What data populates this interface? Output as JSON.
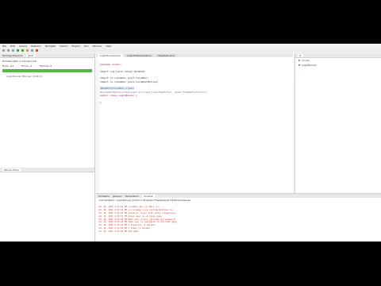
{
  "menu": [
    "File",
    "Edit",
    "Source",
    "Refactor",
    "Navigate",
    "Search",
    "Project",
    "Run",
    "Window",
    "Help"
  ],
  "left": {
    "tabs": [
      "Package Explorer",
      "JUnit"
    ],
    "junit_info": "Finished after 2.144 seconds",
    "runs": "Runs: 1/1",
    "errors": "Errors: 0",
    "failures": "Failures: 0",
    "tree_item": "LoginRunner [Runner: JUnit 4]",
    "problems_tab": "Failure Trace"
  },
  "editor": {
    "tabs": [
      "LoginRunner.java",
      "LoginFeature.feature",
      "StepDefs.java"
    ],
    "lines": [
      "package runner;",
      "",
      "import org.junit.runner.RunWith;",
      "",
      "import io.cucumber.junit.Cucumber;",
      "import io.cucumber.junit.CucumberOptions;",
      "",
      "@RunWith(Cucumber.class)",
      "@CucumberOptions(features=\"src/test/java/Features\", glue=\"stepDefinitions\")",
      "public class LoginRunner {",
      "",
      "}"
    ]
  },
  "outline": {
    "items": [
      "runner",
      "LoginRunner"
    ]
  },
  "console": {
    "tabs": [
      "Problems",
      "Javadoc",
      "Declaration",
      "Console"
    ],
    "terminated": "<terminated> LoginRunner [JUnit] C:\\Program Files\\Java\\jdk-16\\bin\\javaw.exe",
    "logs": [
      "Jul 10, 2021 4:25:14 PM cucumber.api.cli.Main run",
      "Jul 10, 2021 4:25:14 PM io.cucumber.core.runtime.Runtime run",
      "Jul 10, 2021 4:25:15 PM Scenario: Login with valid credentials",
      "Jul 10, 2021 4:25:15 PM Given user is on login page",
      "Jul 10, 2021 4:25:15 PM When user enters username and password",
      "Jul 10, 2021 4:25:16 PM Then user is navigated to the home page",
      "Jul 10, 2021 4:25:16 PM 1 Scenarios (1 passed)",
      "Jul 10, 2021 4:25:16 PM 3 Steps (3 passed)",
      "Jul 10, 2021 4:25:16 PM 0m2.144s"
    ]
  }
}
